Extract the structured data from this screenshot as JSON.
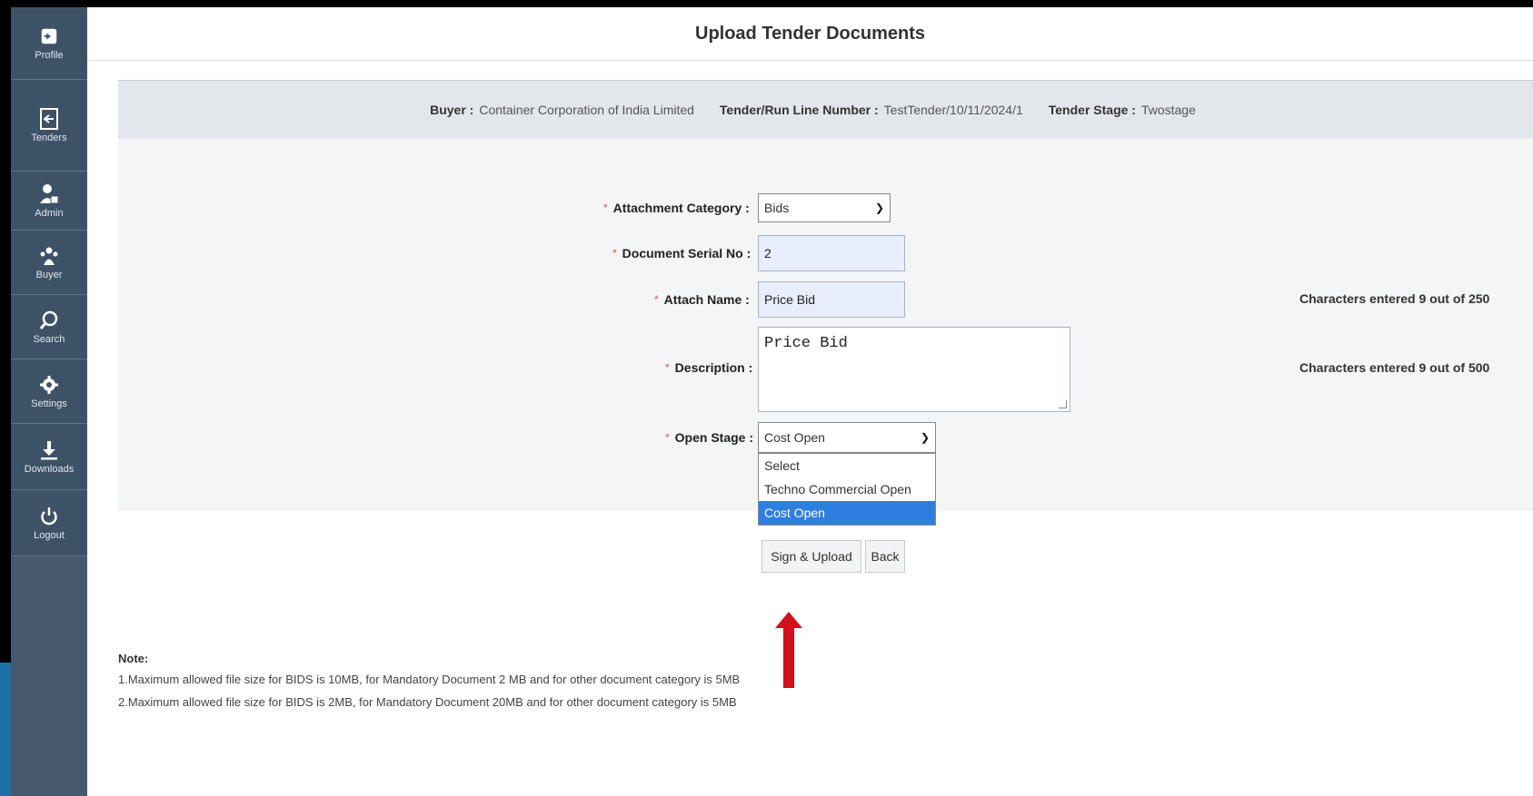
{
  "sidebar": {
    "items": [
      {
        "label": "Profile",
        "icon": "sign-in-icon"
      },
      {
        "label": "Tenders",
        "icon": "tender-doc-icon"
      },
      {
        "label": "Admin",
        "icon": "admin-user-icon"
      },
      {
        "label": "Buyer",
        "icon": "buyer-icon"
      },
      {
        "label": "Search",
        "icon": "search-icon"
      },
      {
        "label": "Settings",
        "icon": "settings-icon"
      },
      {
        "label": "Downloads",
        "icon": "download-icon"
      },
      {
        "label": "Logout",
        "icon": "power-icon"
      }
    ]
  },
  "page": {
    "title": "Upload Tender Documents"
  },
  "info": {
    "buyer_label": "Buyer :",
    "buyer_value": "Container Corporation of India Limited",
    "tender_label": "Tender/Run Line Number :",
    "tender_value": "TestTender/10/11/2024/1",
    "stage_label": "Tender Stage :",
    "stage_value": "Twostage"
  },
  "form": {
    "required_mark": "*",
    "attachment_category": {
      "label": "Attachment Category :",
      "value": "Bids"
    },
    "document_serial": {
      "label": "Document Serial No :",
      "value": "2"
    },
    "attach_name": {
      "label": "Attach Name :",
      "value": "Price Bid",
      "counter": "Characters entered 9 out of 250"
    },
    "description": {
      "label": "Description :",
      "value": "Price Bid",
      "counter": "Characters entered 9 out of 500"
    },
    "open_stage": {
      "label": "Open Stage :",
      "value": "Cost Open",
      "options": [
        "Select",
        "Techno Commercial Open",
        "Cost Open"
      ],
      "selected_index": 2
    }
  },
  "buttons": {
    "sign_upload": "Sign & Upload",
    "back": "Back"
  },
  "note": {
    "title": "Note:",
    "lines": [
      "1.Maximum allowed file size for BIDS is 10MB, for Mandatory Document 2 MB and for other document category is 5MB",
      "2.Maximum allowed file size for BIDS is 2MB, for Mandatory Document 20MB and for other document category is 5MB"
    ]
  },
  "colors": {
    "sidebar": "#3e5267",
    "selected_option": "#2f7fe0",
    "arrow": "#d0101b"
  }
}
